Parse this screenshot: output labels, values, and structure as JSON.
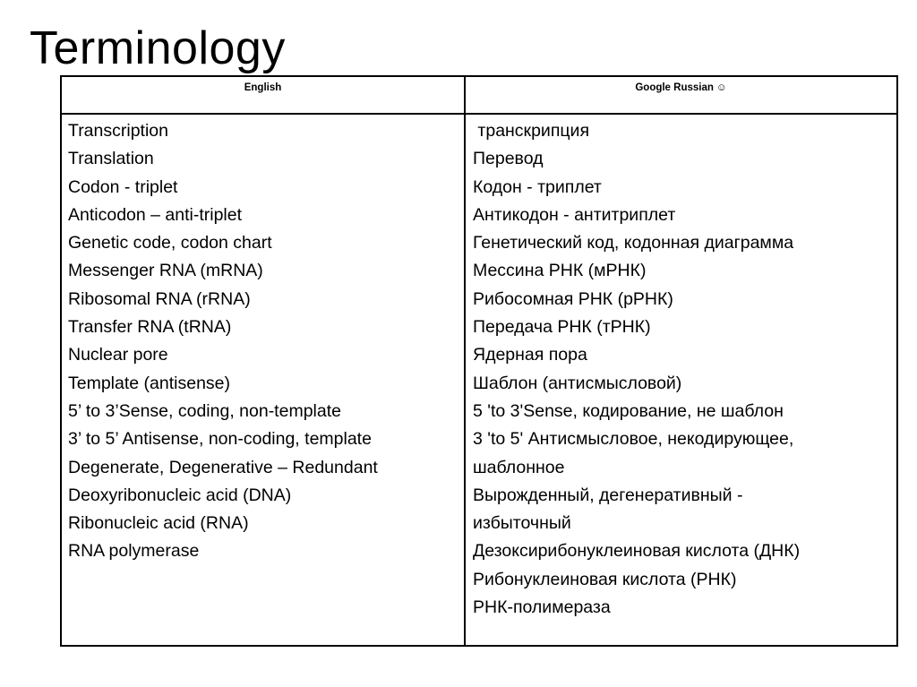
{
  "slide": {
    "title": "Terminology"
  },
  "table": {
    "headers": {
      "english": "English",
      "russian": "Google Russian",
      "russian_icon": "smiley-face-icon",
      "russian_icon_glyph": "☺"
    },
    "english_terms": [
      "Transcription",
      "Translation",
      "Codon - triplet",
      "Anticodon – anti-triplet",
      "Genetic code, codon chart",
      "Messenger RNA (mRNA)",
      "Ribosomal RNA (rRNA)",
      "Transfer RNA (tRNA)",
      "Nuclear pore",
      "Template (antisense)",
      "5’ to 3’Sense, coding, non-template",
      "3’ to 5’ Antisense, non-coding, template",
      "Degenerate, Degenerative – Redundant",
      "Deoxyribonucleic acid (DNA)",
      "Ribonucleic acid (RNA)",
      "RNA polymerase"
    ],
    "russian_lines": [
      " транскрипция",
      "Перевод",
      "Кодон - триплет",
      "Антикодон - антитриплет",
      "Генетический код, кодонная диаграмма",
      "Мессина РНК (мРНК)",
      "Рибосомная РНК (рРНК)",
      "Передача РНК (тРНК)",
      "Ядерная пора",
      "Шаблон (антисмысловой)",
      "5 'to 3'Sense, кодирование, не шаблон",
      "3 'to 5' Антисмысловое, некодирующее,",
      "шаблонное",
      "Вырожденный, дегенеративный -",
      "избыточный",
      "Дезоксирибонуклеиновая кислота (ДНК)",
      "Рибонуклеиновая кислота (РНК)",
      "РНК-полимераза"
    ]
  }
}
